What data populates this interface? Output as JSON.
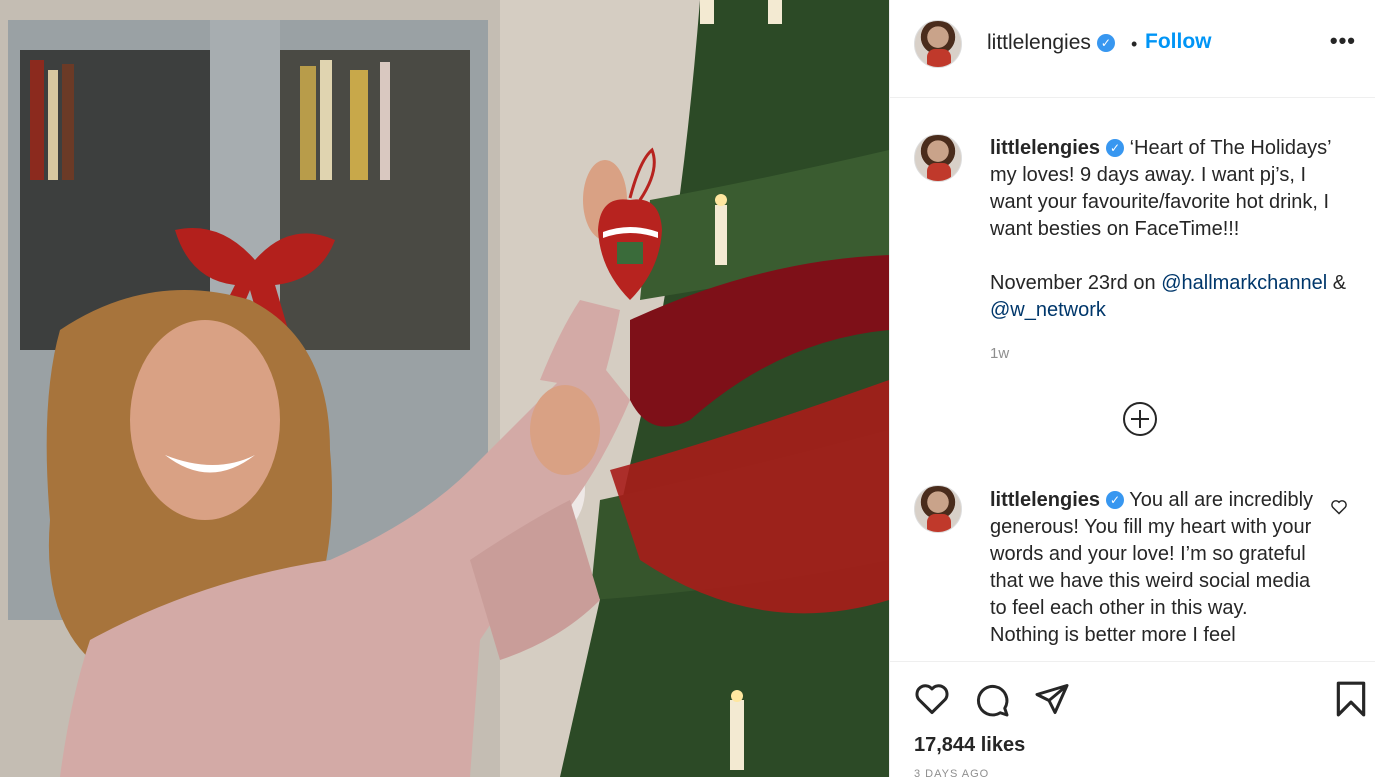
{
  "post": {
    "username": "littlelengies",
    "verified_mark": "✓",
    "separator": "•",
    "follow_label": "Follow",
    "more_label": "•••"
  },
  "caption": {
    "username": "littlelengies",
    "line1": "‘Heart of The Holidays’ my loves! 9 days away. I want pj’s, I want your favourite/favorite hot drink, I want besties on FaceTime!!!",
    "line2_prefix": "November 23rd on ",
    "mention1": "@hallmarkchannel",
    "line2_middle": " & ",
    "mention2": "@w_network",
    "time": "1w"
  },
  "comment": {
    "username": "littlelengies",
    "text": "You all are incredibly generous! You fill my heart with your words and your love! I’m so grateful that we have this weird social media to feel each other in this way. Nothing is better more I feel"
  },
  "footer": {
    "likes": "17,844 likes",
    "posted": "3 DAYS AGO"
  },
  "icons": {
    "like": "heart-icon",
    "comment": "comment-icon",
    "share": "paper-plane-icon",
    "save": "bookmark-icon",
    "load_more": "plus-circle-icon",
    "comment_like": "heart-outline-icon"
  },
  "colors": {
    "accent": "#0095f6",
    "verified": "#3897f0",
    "mention": "#00376b",
    "muted": "#8e8e8e"
  }
}
